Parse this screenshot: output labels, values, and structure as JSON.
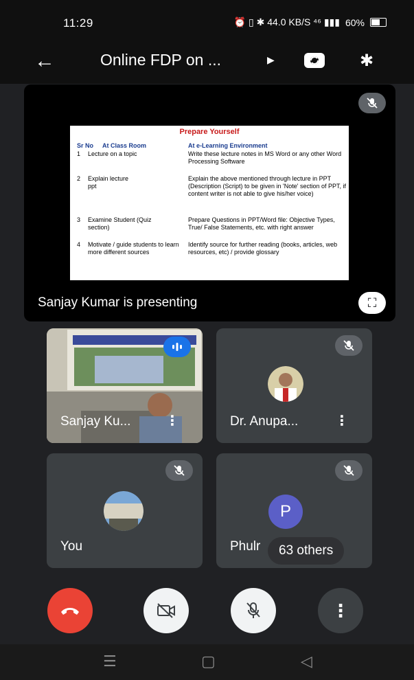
{
  "status_bar": {
    "time": "11:29",
    "icons_right": "⏰ ▯ ✱ 44.0 KB/S ⁴⁶ ▮▮▮",
    "battery": "60%"
  },
  "header": {
    "back_icon": "←",
    "title": "Online FDP on ...",
    "caret": "▶",
    "bluetooth_icon": "✱"
  },
  "presentation": {
    "slide": {
      "title": "Prepare Yourself",
      "col_sr": "Sr No",
      "col_class": "At Class Room",
      "col_elearn": "At e-Learning Environment",
      "rows": [
        {
          "sr": "1",
          "class": "Lecture on a topic",
          "elearn": "Write these lecture notes in MS Word or any other Word Processing Software"
        },
        {
          "sr": "2",
          "class": "Explain lecture ppt",
          "elearn": "Explain the above mentioned through lecture in PPT (Description (Script) to be given in 'Note' section of PPT, if content writer is not able to give his/her voice)"
        },
        {
          "sr": "3",
          "class": "Examine Student (Quiz section)",
          "elearn": "Prepare Questions in PPT/Word file: Objective Types, True/ False Statements, etc. with right answer"
        },
        {
          "sr": "4",
          "class": "Motivate / guide students to learn more different sources",
          "elearn": "Identify source for further reading (books, articles, web resources, etc) / provide glossary"
        }
      ]
    },
    "presenting_text": "Sanjay Kumar is presenting",
    "fullscreen_icon": "⛶"
  },
  "participants": [
    {
      "name": "Sanjay Ku...",
      "more": "⋮"
    },
    {
      "name": "Dr. Anupa...",
      "more": "⋮"
    },
    {
      "name": "You"
    },
    {
      "name": "Phulr",
      "avatar_letter": "P",
      "others_label": "63 others"
    }
  ],
  "controls": {
    "more_icon": "⋮"
  },
  "nav": {
    "menu": "☰",
    "home": "▢",
    "back": "◁"
  },
  "colors": {
    "background": "#202124",
    "end_call": "#ea4335",
    "avatar_p": "#5b5fc7",
    "slide_title": "#c81b1b",
    "slide_heading": "#1a3c8f"
  }
}
